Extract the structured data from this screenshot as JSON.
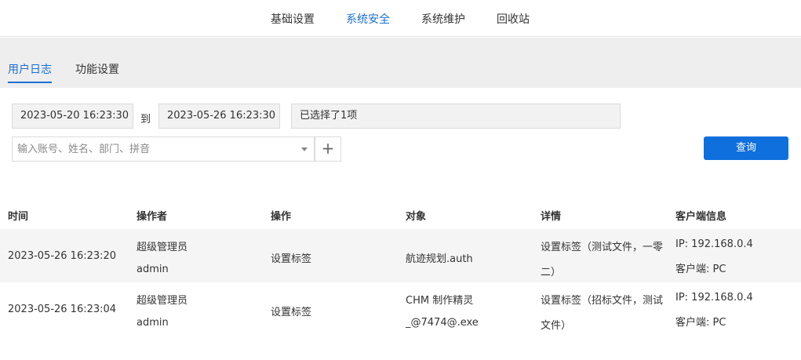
{
  "top_tabs": [
    {
      "label": "基础设置"
    },
    {
      "label": "系统安全"
    },
    {
      "label": "系统维护"
    },
    {
      "label": "回收站"
    }
  ],
  "sub_tabs": [
    {
      "label": "用户日志"
    },
    {
      "label": "功能设置"
    }
  ],
  "filters": {
    "start_time": "2023-05-20 16:23:30",
    "to_label": "到",
    "end_time": "2023-05-26 16:23:30",
    "selection": "已选择了1项",
    "search_placeholder": "输入账号、姓名、部门、拼音",
    "add_label": "+",
    "query_label": "查询"
  },
  "table": {
    "headers": [
      "时间",
      "操作者",
      "操作",
      "对象",
      "详情",
      "客户端信息"
    ],
    "rows": [
      {
        "time": "2023-05-26 16:23:20",
        "operator_name": "超级管理员",
        "operator_account": "admin",
        "action": "设置标签",
        "object_line1": "航迹规划.auth",
        "object_line2": "",
        "detail_line1": "设置标签（测试文件，一零",
        "detail_line2": "二）",
        "client_ip": "IP: 192.168.0.4",
        "client_type": "客户端: PC"
      },
      {
        "time": "2023-05-26 16:23:04",
        "operator_name": "超级管理员",
        "operator_account": "admin",
        "action": "设置标签",
        "object_line1": "CHM 制作精灵",
        "object_line2": "_@7474@.exe",
        "detail_line1": "设置标签（招标文件，测试",
        "detail_line2": "文件）",
        "client_ip": "IP: 192.168.0.4",
        "client_type": "客户端: PC"
      }
    ]
  },
  "colors": {
    "accent": "#1a6fd4",
    "button": "#0f6fdc",
    "subbar_bg": "#eeeeee",
    "row_alt_bg": "#f5f5f5"
  }
}
